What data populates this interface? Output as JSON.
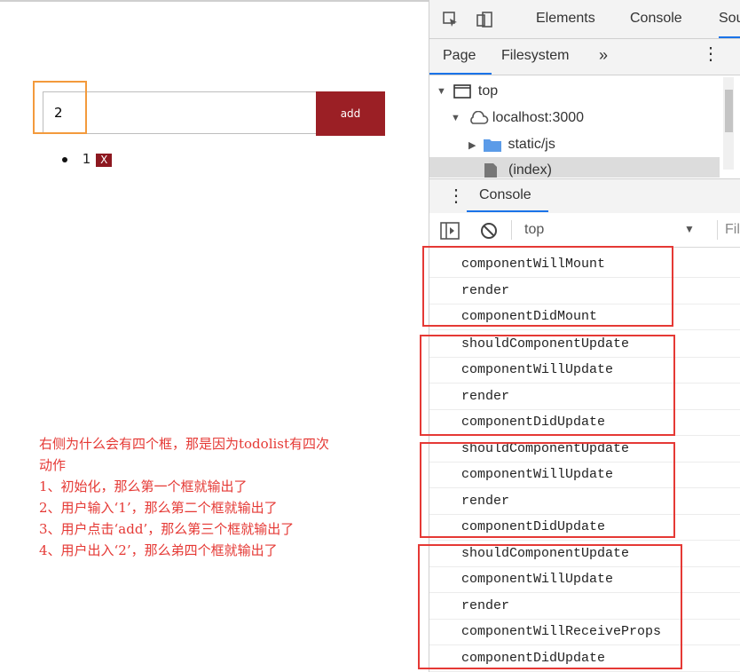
{
  "app": {
    "input_value": "2",
    "add_label": "add",
    "todo_items": [
      {
        "text": "1",
        "delete_label": "X"
      }
    ]
  },
  "annotation": {
    "lines": [
      "右侧为什么会有四个框，那是因为todolist有四次",
      "动作",
      "1、初始化，那么第一个框就输出了",
      "2、用户输入‘1’，那么第二个框就输出了",
      "3、用户点击‘add’，那么第三个框就输出了",
      "4、用户出入‘2’，那么弟四个框就输出了"
    ]
  },
  "devtools": {
    "top_tabs": [
      "Elements",
      "Console",
      "Sou"
    ],
    "subtabs": [
      "Page",
      "Filesystem"
    ],
    "tree": {
      "top": "top",
      "host": "localhost:3000",
      "folder": "static/js",
      "file": "(index)"
    },
    "drawer_title": "Console",
    "context": "top",
    "filter_placeholder": "Filt"
  },
  "console": {
    "logs": [
      "componentWillMount",
      "render",
      "componentDidMount",
      "shouldComponentUpdate",
      "componentWillUpdate",
      "render",
      "componentDidUpdate",
      "shouldComponentUpdate",
      "componentWillUpdate",
      "render",
      "componentDidUpdate",
      "shouldComponentUpdate",
      "componentWillUpdate",
      "render",
      "componentWillReceiveProps",
      "componentDidUpdate"
    ]
  },
  "colors": {
    "accent_blue": "#1a73e8",
    "add_button": "#9b1f25",
    "highlight_orange": "#f39a3c",
    "annotation_red": "#e53935"
  }
}
